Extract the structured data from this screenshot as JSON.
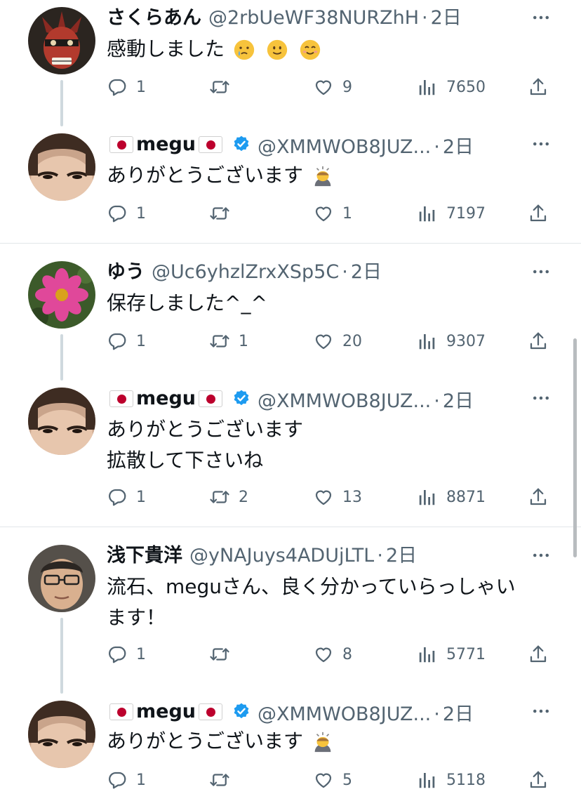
{
  "tweets": [
    {
      "name": "さくらあん",
      "handle": "@2rbUeWF38NURZhH",
      "time": "2日",
      "text": "感動しました",
      "replies": "1",
      "retweets": "",
      "likes": "9",
      "views": "7650"
    },
    {
      "name": "megu",
      "handle": "@XMMWOB8JUZ...",
      "time": "2日",
      "text": "ありがとうございます",
      "replies": "1",
      "retweets": "",
      "likes": "1",
      "views": "7197"
    },
    {
      "name": "ゆう",
      "handle": "@Uc6yhzlZrxXSp5C",
      "time": "2日",
      "text": "保存しました^_^",
      "replies": "1",
      "retweets": "1",
      "likes": "20",
      "views": "9307"
    },
    {
      "name": "megu",
      "handle": "@XMMWOB8JUZ...",
      "time": "2日",
      "text_line1": "ありがとうございます",
      "text_line2": "拡散して下さいね",
      "replies": "1",
      "retweets": "2",
      "likes": "13",
      "views": "8871"
    },
    {
      "name": "浅下貴洋",
      "handle": "@yNAJuys4ADUjLTL",
      "time": "2日",
      "text_line1": "流石、meguさん、良く分かっていらっしゃい",
      "text_line2": "ます！",
      "replies": "1",
      "retweets": "",
      "likes": "8",
      "views": "5771"
    },
    {
      "name": "megu",
      "handle": "@XMMWOB8JUZ...",
      "time": "2日",
      "text": "ありがとうございます",
      "replies": "1",
      "retweets": "",
      "likes": "5",
      "views": "5118"
    }
  ],
  "separator": "·",
  "colors": {
    "secondary_text": "#536471",
    "verified": "#1d9bf0",
    "flag_red": "#bc002d",
    "thread_line": "#cfd9de"
  }
}
